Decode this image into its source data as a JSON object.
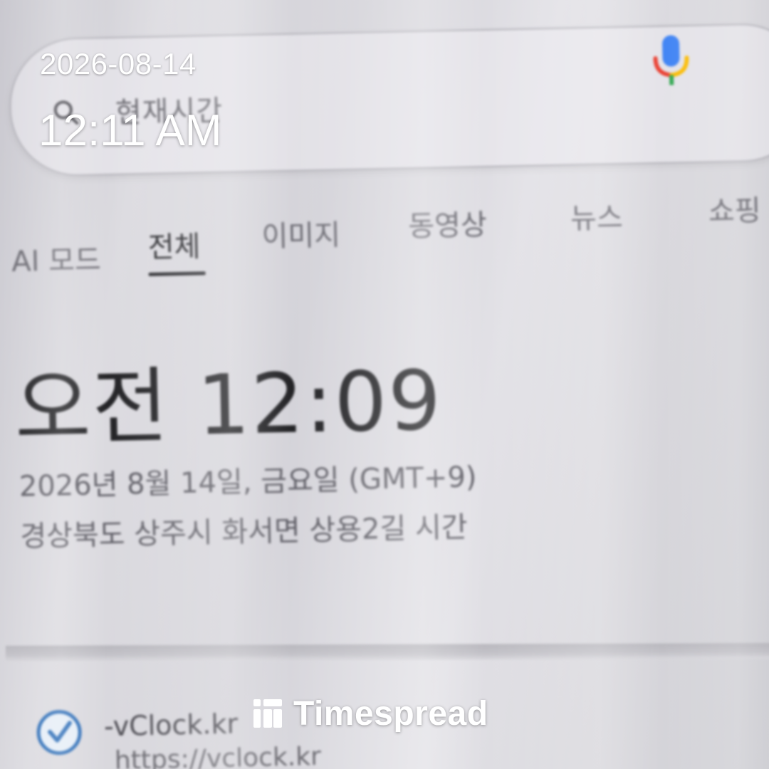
{
  "overlay": {
    "date": "2026-08-14",
    "time": "12:11 AM",
    "brand_name": "Timespread"
  },
  "search": {
    "query": "현재시간",
    "search_icon": "search-icon",
    "mic_icon": "mic-icon"
  },
  "tabs": [
    {
      "label": "AI 모드",
      "active": false
    },
    {
      "label": "전체",
      "active": true
    },
    {
      "label": "이미지",
      "active": false
    },
    {
      "label": "동영상",
      "active": false
    },
    {
      "label": "뉴스",
      "active": false
    },
    {
      "label": "쇼핑",
      "active": false
    }
  ],
  "result": {
    "time": "오전 12:09",
    "date": "2026년 8월 14일, 금요일 (GMT+9)",
    "location": "경상북도 상주시 화서면 상용2길 시간"
  },
  "first_result": {
    "site": "vClock.kr",
    "url": "https://vclock.kr",
    "icon": "check-clock-icon"
  },
  "colors": {
    "page_bg": "#d8d7dc",
    "text_dark": "#232326",
    "text_gray": "#5f5e66",
    "overlay_text": "#ffffff",
    "mic_blue": "#4285F4",
    "mic_red": "#EA4335",
    "mic_yellow": "#FBBC05",
    "mic_green": "#34A853",
    "vclock_blue": "#2f6fb8"
  }
}
